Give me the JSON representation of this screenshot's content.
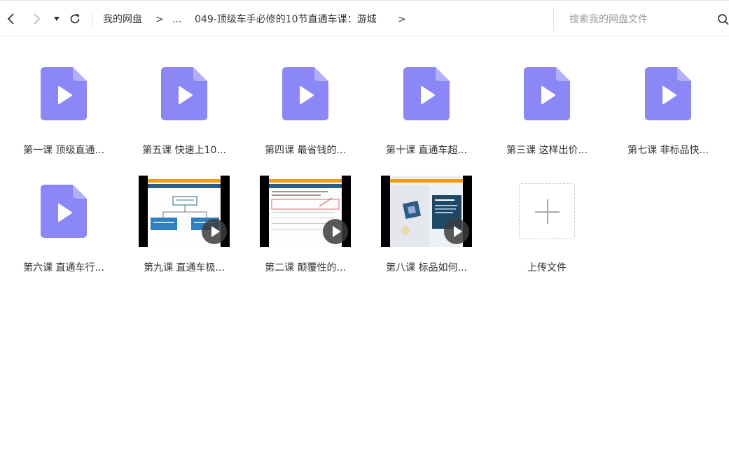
{
  "toolbar": {
    "breadcrumb": [
      {
        "label": "我的网盘"
      },
      {
        "label": ">"
      },
      {
        "label": "..."
      },
      {
        "label": "049-顶级车手必修的10节直通车课：游城"
      },
      {
        "label": ">"
      }
    ],
    "search_placeholder": "搜索我的网盘文件"
  },
  "files": [
    {
      "name": "第一课 顶级直通...",
      "kind": "video-file-icon"
    },
    {
      "name": "第五课 快速上10...",
      "kind": "video-file-icon"
    },
    {
      "name": "第四课 最省钱的...",
      "kind": "video-file-icon"
    },
    {
      "name": "第十课 直通车超...",
      "kind": "video-file-icon"
    },
    {
      "name": "第三课 这样出价...",
      "kind": "video-file-icon"
    },
    {
      "name": "第七课 非标品快...",
      "kind": "video-file-icon"
    },
    {
      "name": "第六课 直通车行...",
      "kind": "video-file-icon"
    },
    {
      "name": "第九课 直通车极...",
      "kind": "video-thumbnail"
    },
    {
      "name": "第二课 颠覆性的...",
      "kind": "video-thumbnail"
    },
    {
      "name": "第八课 标品如何...",
      "kind": "video-thumbnail"
    }
  ],
  "upload": {
    "label": "上传文件"
  },
  "colors": {
    "file_icon": "#8b87f7",
    "accent_orange": "#f39c12",
    "slide_blue": "#2c5d84"
  }
}
